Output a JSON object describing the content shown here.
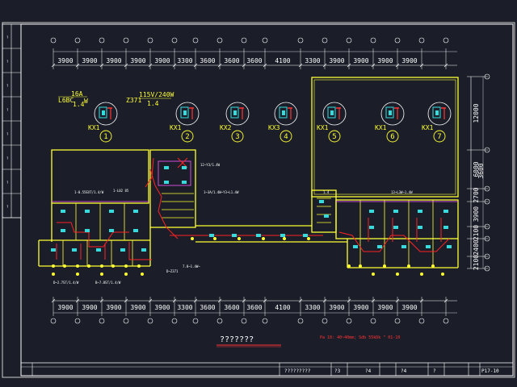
{
  "drawing_title": "???????",
  "top_dims": [
    "3900",
    "3900",
    "3900",
    "3900",
    "3900",
    "3300",
    "3600",
    "3600",
    "3600",
    "4100",
    "3300",
    "3900",
    "3900",
    "3900",
    "3900"
  ],
  "bottom_dims": [
    "3900",
    "3900",
    "3900",
    "3900",
    "3900",
    "3300",
    "3600",
    "3600",
    "3600",
    "4100",
    "3300",
    "3900",
    "3900",
    "3900",
    "3900"
  ],
  "right_dims": [
    "12000",
    "6000",
    "2700",
    "3900",
    "2100",
    "2400",
    "2100"
  ],
  "right_dims_extra": "3600",
  "room_numbers": [
    "1",
    "2",
    "3",
    "4",
    "5",
    "6",
    "7"
  ],
  "room_labels": [
    "KX1",
    "KX1",
    "KX2",
    "KX3",
    "KX1",
    "KX1",
    "KX1"
  ],
  "annotation_left_top": "16A",
  "annotation_left_main": "L6BC",
  "annotation_left_sub": "1.4",
  "annotation_left_w": "W",
  "annotation_right_top": "Z371",
  "annotation_right_main": "115V/240W",
  "annotation_right_sub": "1.4",
  "red_note": "Pa 10: 40~40mm; Sdb 55kDk \"  01-10",
  "title_block": {
    "drawing_name": "?????????",
    "cell_a": "?3",
    "cell_b": "?4",
    "cell_c": "?4",
    "cell_d": "?",
    "sheet_code": "P17-10"
  },
  "sidebar_labels": [
    "?",
    "?",
    "?",
    "?",
    "?",
    "?",
    "?",
    "?"
  ]
}
